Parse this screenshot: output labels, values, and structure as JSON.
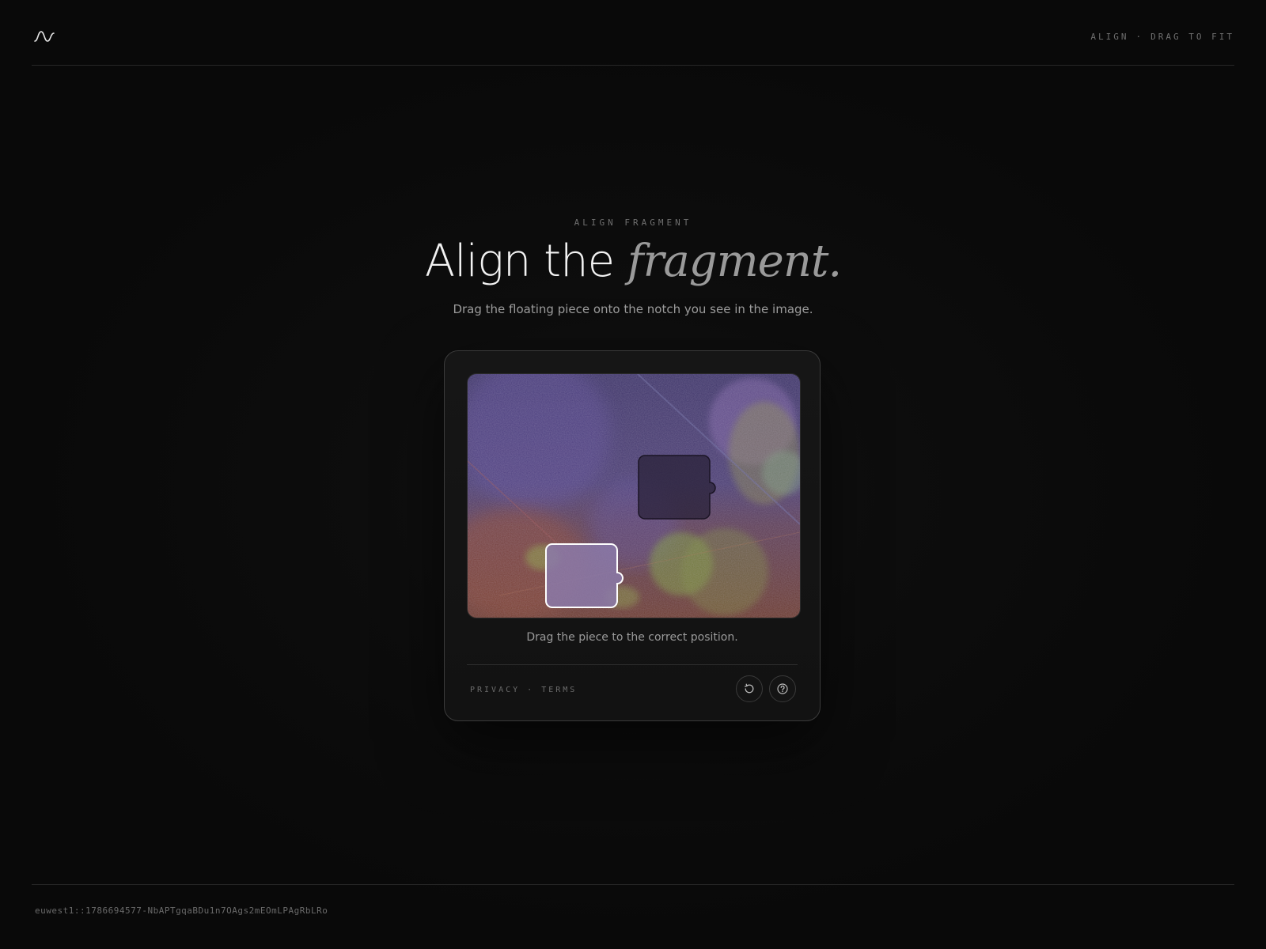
{
  "header": {
    "meta_left": "ALIGN",
    "meta_sep": "·",
    "meta_right": "DRAG TO FIT",
    "logo_icon": "wave-logo-icon"
  },
  "hero": {
    "eyebrow": "ALIGN FRAGMENT",
    "title_main": "Align the ",
    "title_accent": "fragment.",
    "subtitle": "Drag the floating piece onto the notch you see in the image."
  },
  "card": {
    "instruction": "Drag the piece to the correct position.",
    "privacy_label": "PRIVACY",
    "links_sep": "·",
    "terms_label": "TERMS",
    "refresh_icon": "refresh-icon",
    "help_icon": "help-icon"
  },
  "footer": {
    "session_id": "euwest1::1786694577-NbAPTgqaBDu1n7OAgs2mEOmLPAgRbLRo"
  },
  "colors": {
    "background": "#0a0a0a",
    "card_border": "#3b3b3b",
    "piece_outline": "#ffffff",
    "image_purple": "#4b3a78",
    "image_orange": "#7a4030",
    "image_green": "#6f8a3a"
  }
}
